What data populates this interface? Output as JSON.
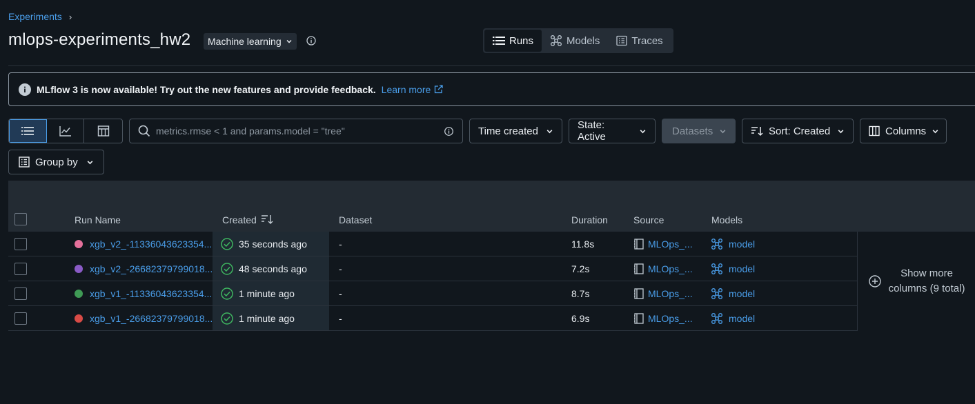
{
  "breadcrumb": {
    "root": "Experiments",
    "separator": "›"
  },
  "header": {
    "title": "mlops-experiments_hw2",
    "type_badge": "Machine learning",
    "tabs": [
      {
        "label": "Runs",
        "icon": "list-icon",
        "active": true
      },
      {
        "label": "Models",
        "icon": "models-icon",
        "active": false
      },
      {
        "label": "Traces",
        "icon": "traces-icon",
        "active": false
      }
    ]
  },
  "banner": {
    "message": "MLflow 3 is now available! Try out the new features and provide feedback.",
    "link": "Learn more"
  },
  "toolbar": {
    "search_placeholder": "metrics.rmse < 1 and params.model = \"tree\"",
    "time_created": "Time created",
    "state": "State: Active",
    "datasets": "Datasets",
    "sort": "Sort: Created",
    "columns": "Columns",
    "group_by": "Group by"
  },
  "table": {
    "headers": {
      "run_name": "Run Name",
      "created": "Created",
      "dataset": "Dataset",
      "duration": "Duration",
      "source": "Source",
      "models": "Models"
    },
    "rows": [
      {
        "color": "#e4709b",
        "run_name": "xgb_v2_-11336043623354...",
        "created": "35 seconds ago",
        "dataset": "-",
        "duration": "11.8s",
        "source": "MLOps_...",
        "model": "model"
      },
      {
        "color": "#8a5bc6",
        "run_name": "xgb_v2_-26682379799018...",
        "created": "48 seconds ago",
        "dataset": "-",
        "duration": "7.2s",
        "source": "MLOps_...",
        "model": "model"
      },
      {
        "color": "#3f9a55",
        "run_name": "xgb_v1_-11336043623354...",
        "created": "1 minute ago",
        "dataset": "-",
        "duration": "8.7s",
        "source": "MLOps_...",
        "model": "model"
      },
      {
        "color": "#d94b46",
        "run_name": "xgb_v1_-26682379799018...",
        "created": "1 minute ago",
        "dataset": "-",
        "duration": "6.9s",
        "source": "MLOps_...",
        "model": "model"
      }
    ],
    "show_more": {
      "line1": "Show more",
      "line2": "columns (9 total)"
    }
  },
  "colors": {
    "accent": "#4a9eea",
    "success": "#3fb760",
    "background": "#11171d"
  }
}
